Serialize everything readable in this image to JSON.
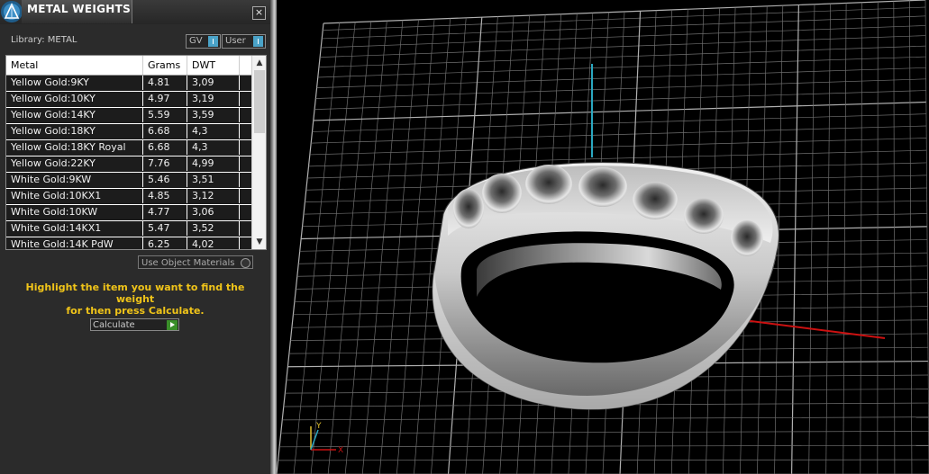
{
  "window": {
    "title": "METAL WEIGHTS",
    "close_glyph": "×"
  },
  "library": {
    "label": "Library: METAL"
  },
  "toggles": {
    "gv": "GV",
    "user": "User"
  },
  "table": {
    "columns": [
      "Metal",
      "Grams",
      "DWT"
    ],
    "rows": [
      [
        "Yellow Gold:9KY",
        "4.81",
        "3,09"
      ],
      [
        "Yellow Gold:10KY",
        "4.97",
        "3,19"
      ],
      [
        "Yellow Gold:14KY",
        "5.59",
        "3,59"
      ],
      [
        "Yellow Gold:18KY",
        "6.68",
        "4,3"
      ],
      [
        "Yellow Gold:18KY Royal",
        "6.68",
        "4,3"
      ],
      [
        "Yellow Gold:22KY",
        "7.76",
        "4,99"
      ],
      [
        "White Gold:9KW",
        "5.46",
        "3,51"
      ],
      [
        "White Gold:10KX1",
        "4.85",
        "3,12"
      ],
      [
        "White Gold:10KW",
        "4.77",
        "3,06"
      ],
      [
        "White Gold:14KX1",
        "5.47",
        "3,52"
      ],
      [
        "White Gold:14K PdW",
        "6.25",
        "4,02"
      ]
    ]
  },
  "options": {
    "use_object_materials": "Use Object Materials"
  },
  "hint": {
    "line1": "Highlight the item you want to find the weight",
    "line2": "for then press Calculate."
  },
  "actions": {
    "calculate": "Calculate"
  },
  "icons": {
    "app": "app-logo-icon",
    "close": "close-icon",
    "scroll_up": "chevron-up-icon",
    "scroll_down": "chevron-down-icon",
    "go": "play-arrow-icon",
    "axis": "axis-triad-icon"
  },
  "colors": {
    "hint": "#f0c419",
    "accent": "#4aa3c8",
    "go": "#3a8f2a",
    "axis_x": "#cc1111",
    "axis_y": "#2aa7c0",
    "grid": "#8a8a8a"
  },
  "viewport": {
    "axis_x_label": "X",
    "axis_y_label": "Y"
  }
}
